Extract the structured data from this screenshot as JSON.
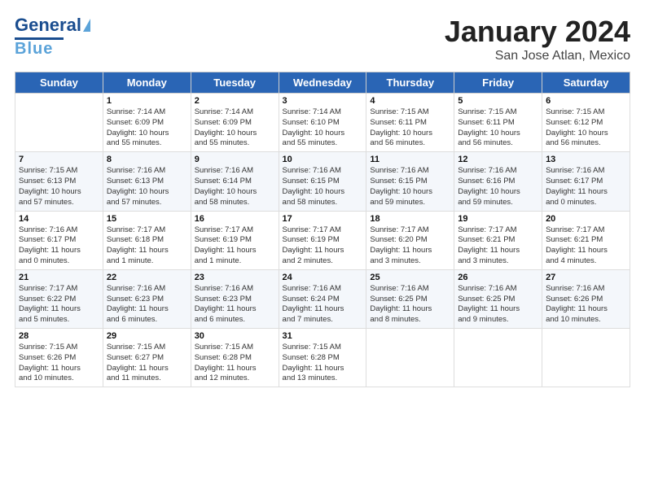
{
  "logo": {
    "line1": "General",
    "line2": "Blue"
  },
  "title": "January 2024",
  "subtitle": "San Jose Atlan, Mexico",
  "days_of_week": [
    "Sunday",
    "Monday",
    "Tuesday",
    "Wednesday",
    "Thursday",
    "Friday",
    "Saturday"
  ],
  "weeks": [
    [
      {
        "day": "",
        "info": ""
      },
      {
        "day": "1",
        "info": "Sunrise: 7:14 AM\nSunset: 6:09 PM\nDaylight: 10 hours\nand 55 minutes."
      },
      {
        "day": "2",
        "info": "Sunrise: 7:14 AM\nSunset: 6:09 PM\nDaylight: 10 hours\nand 55 minutes."
      },
      {
        "day": "3",
        "info": "Sunrise: 7:14 AM\nSunset: 6:10 PM\nDaylight: 10 hours\nand 55 minutes."
      },
      {
        "day": "4",
        "info": "Sunrise: 7:15 AM\nSunset: 6:11 PM\nDaylight: 10 hours\nand 56 minutes."
      },
      {
        "day": "5",
        "info": "Sunrise: 7:15 AM\nSunset: 6:11 PM\nDaylight: 10 hours\nand 56 minutes."
      },
      {
        "day": "6",
        "info": "Sunrise: 7:15 AM\nSunset: 6:12 PM\nDaylight: 10 hours\nand 56 minutes."
      }
    ],
    [
      {
        "day": "7",
        "info": "Sunrise: 7:15 AM\nSunset: 6:13 PM\nDaylight: 10 hours\nand 57 minutes."
      },
      {
        "day": "8",
        "info": "Sunrise: 7:16 AM\nSunset: 6:13 PM\nDaylight: 10 hours\nand 57 minutes."
      },
      {
        "day": "9",
        "info": "Sunrise: 7:16 AM\nSunset: 6:14 PM\nDaylight: 10 hours\nand 58 minutes."
      },
      {
        "day": "10",
        "info": "Sunrise: 7:16 AM\nSunset: 6:15 PM\nDaylight: 10 hours\nand 58 minutes."
      },
      {
        "day": "11",
        "info": "Sunrise: 7:16 AM\nSunset: 6:15 PM\nDaylight: 10 hours\nand 59 minutes."
      },
      {
        "day": "12",
        "info": "Sunrise: 7:16 AM\nSunset: 6:16 PM\nDaylight: 10 hours\nand 59 minutes."
      },
      {
        "day": "13",
        "info": "Sunrise: 7:16 AM\nSunset: 6:17 PM\nDaylight: 11 hours\nand 0 minutes."
      }
    ],
    [
      {
        "day": "14",
        "info": "Sunrise: 7:16 AM\nSunset: 6:17 PM\nDaylight: 11 hours\nand 0 minutes."
      },
      {
        "day": "15",
        "info": "Sunrise: 7:17 AM\nSunset: 6:18 PM\nDaylight: 11 hours\nand 1 minute."
      },
      {
        "day": "16",
        "info": "Sunrise: 7:17 AM\nSunset: 6:19 PM\nDaylight: 11 hours\nand 1 minute."
      },
      {
        "day": "17",
        "info": "Sunrise: 7:17 AM\nSunset: 6:19 PM\nDaylight: 11 hours\nand 2 minutes."
      },
      {
        "day": "18",
        "info": "Sunrise: 7:17 AM\nSunset: 6:20 PM\nDaylight: 11 hours\nand 3 minutes."
      },
      {
        "day": "19",
        "info": "Sunrise: 7:17 AM\nSunset: 6:21 PM\nDaylight: 11 hours\nand 3 minutes."
      },
      {
        "day": "20",
        "info": "Sunrise: 7:17 AM\nSunset: 6:21 PM\nDaylight: 11 hours\nand 4 minutes."
      }
    ],
    [
      {
        "day": "21",
        "info": "Sunrise: 7:17 AM\nSunset: 6:22 PM\nDaylight: 11 hours\nand 5 minutes."
      },
      {
        "day": "22",
        "info": "Sunrise: 7:16 AM\nSunset: 6:23 PM\nDaylight: 11 hours\nand 6 minutes."
      },
      {
        "day": "23",
        "info": "Sunrise: 7:16 AM\nSunset: 6:23 PM\nDaylight: 11 hours\nand 6 minutes."
      },
      {
        "day": "24",
        "info": "Sunrise: 7:16 AM\nSunset: 6:24 PM\nDaylight: 11 hours\nand 7 minutes."
      },
      {
        "day": "25",
        "info": "Sunrise: 7:16 AM\nSunset: 6:25 PM\nDaylight: 11 hours\nand 8 minutes."
      },
      {
        "day": "26",
        "info": "Sunrise: 7:16 AM\nSunset: 6:25 PM\nDaylight: 11 hours\nand 9 minutes."
      },
      {
        "day": "27",
        "info": "Sunrise: 7:16 AM\nSunset: 6:26 PM\nDaylight: 11 hours\nand 10 minutes."
      }
    ],
    [
      {
        "day": "28",
        "info": "Sunrise: 7:15 AM\nSunset: 6:26 PM\nDaylight: 11 hours\nand 10 minutes."
      },
      {
        "day": "29",
        "info": "Sunrise: 7:15 AM\nSunset: 6:27 PM\nDaylight: 11 hours\nand 11 minutes."
      },
      {
        "day": "30",
        "info": "Sunrise: 7:15 AM\nSunset: 6:28 PM\nDaylight: 11 hours\nand 12 minutes."
      },
      {
        "day": "31",
        "info": "Sunrise: 7:15 AM\nSunset: 6:28 PM\nDaylight: 11 hours\nand 13 minutes."
      },
      {
        "day": "",
        "info": ""
      },
      {
        "day": "",
        "info": ""
      },
      {
        "day": "",
        "info": ""
      }
    ]
  ]
}
